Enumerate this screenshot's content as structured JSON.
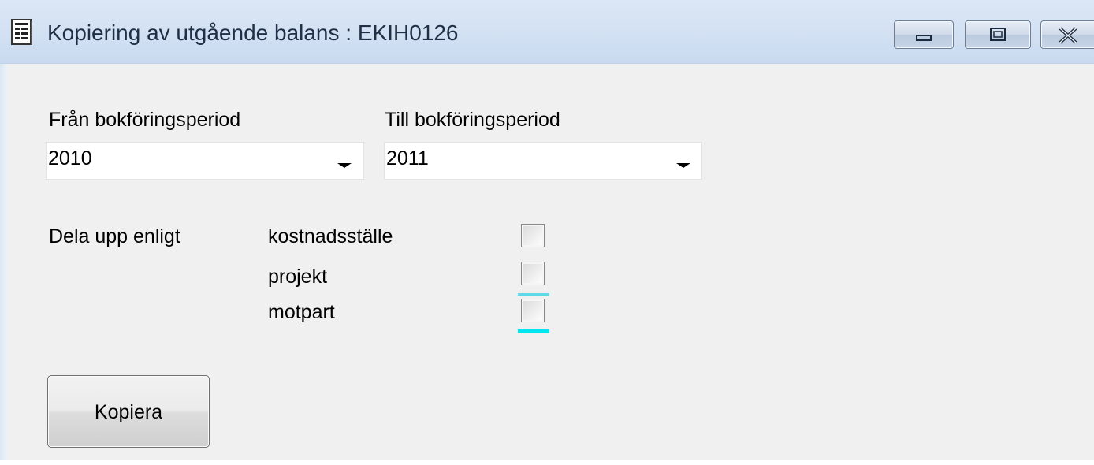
{
  "window": {
    "title": "Kopiering av utgående balans : EKIH0126",
    "icon": "document-icon",
    "controls": {
      "minimize": "minimize-icon",
      "maximize": "maximize-icon",
      "close": "close-icon"
    }
  },
  "form": {
    "from_period": {
      "label": "Från bokföringsperiod",
      "value": "2010"
    },
    "to_period": {
      "label": "Till bokföringsperiod",
      "value": "2011"
    },
    "split": {
      "label": "Dela upp enligt",
      "options": [
        {
          "label": "kostnadsställe",
          "checked": false
        },
        {
          "label": "projekt",
          "checked": false
        },
        {
          "label": "motpart",
          "checked": false,
          "focused": true
        }
      ]
    },
    "copy_button": "Kopiera"
  },
  "colors": {
    "titlebar": "#d3e1f3",
    "background": "#f0f0f0",
    "focus": "#00e5f0"
  }
}
